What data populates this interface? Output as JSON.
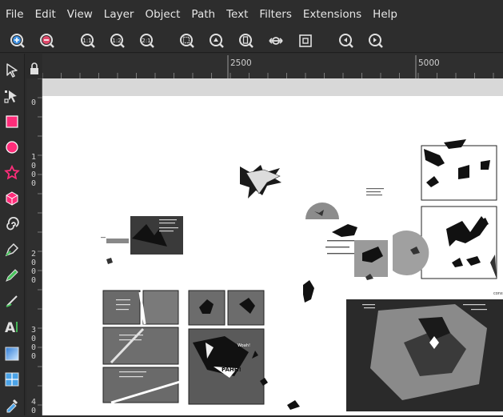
{
  "menu": {
    "items": [
      "File",
      "Edit",
      "View",
      "Layer",
      "Object",
      "Path",
      "Text",
      "Filters",
      "Extensions",
      "Help"
    ]
  },
  "commands": [
    {
      "name": "zoom-in-icon",
      "label": "zoom in"
    },
    {
      "name": "zoom-out-icon",
      "label": "zoom out"
    },
    {
      "name": "zoom-1-1-icon",
      "label": "1:1"
    },
    {
      "name": "zoom-1-2-icon",
      "label": "1:2"
    },
    {
      "name": "zoom-2-1-icon",
      "label": "2:1"
    },
    {
      "name": "zoom-selection-icon",
      "label": "zoom selection"
    },
    {
      "name": "zoom-drawing-icon",
      "label": "zoom drawing"
    },
    {
      "name": "zoom-page-icon",
      "label": "zoom page"
    },
    {
      "name": "zoom-page-width-icon",
      "label": "zoom page width"
    },
    {
      "name": "zoom-center-icon",
      "label": "center page"
    },
    {
      "name": "zoom-prev-icon",
      "label": "previous zoom"
    },
    {
      "name": "zoom-next-icon",
      "label": "next zoom"
    }
  ],
  "zoom_labels": {
    "one_one": "1:1",
    "one_two": "1:2",
    "two_one": "2:1"
  },
  "tools": [
    "selector-tool-icon",
    "node-tool-icon",
    "rectangle-tool-icon",
    "ellipse-tool-icon",
    "star-tool-icon",
    "3d-box-tool-icon",
    "spiral-tool-icon",
    "pen-tool-icon",
    "pencil-tool-icon",
    "calligraphy-tool-icon",
    "text-tool-icon",
    "gradient-tool-icon",
    "mesh-tool-icon",
    "dropper-tool-icon"
  ],
  "text_tool_label": "A",
  "hruler": {
    "labels": [
      "2500",
      "5000"
    ]
  },
  "vruler": {
    "groups": [
      {
        "digits": [
          "0"
        ]
      },
      {
        "digits": [
          "1",
          "0",
          "0",
          "0"
        ]
      },
      {
        "digits": [
          "2",
          "0",
          "0",
          "0"
        ]
      },
      {
        "digits": [
          "3",
          "0",
          "0",
          "0"
        ]
      },
      {
        "digits": [
          "4",
          "0"
        ]
      }
    ]
  },
  "canvas_texts": {
    "pahh": "PAHH!",
    "whoa": "Woah!",
    "const": "constr"
  },
  "colors": {
    "rect_tool": "#ff2d7a",
    "ellipse_tool": "#ff2d7a",
    "star_tool": "#ff2d7a",
    "box_tool": "#ff2d7a",
    "accent_blue": "#4aa3e8",
    "pen_green": "#46c35a"
  }
}
